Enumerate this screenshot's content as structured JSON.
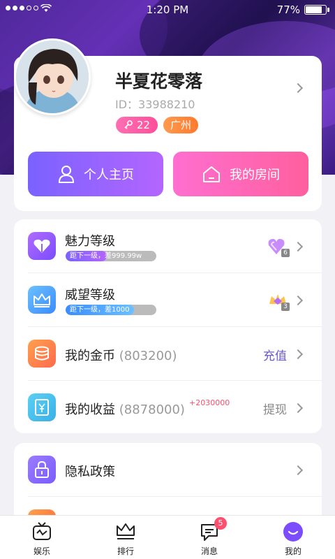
{
  "status_bar": {
    "time": "1:20 PM",
    "battery": "77%"
  },
  "profile": {
    "name": "半夏花零落",
    "id_label": "ID：",
    "id": "33988210",
    "level": "22",
    "city": "广州"
  },
  "actions": {
    "home_label": "个人主页",
    "room_label": "我的房间"
  },
  "rows": [
    {
      "title": "魅力等级",
      "progress_text": "距下一级，差999.99w",
      "progress": 0.45,
      "level_icon": "purple-heart-gem-icon",
      "level": "6"
    },
    {
      "title": "威望等级",
      "progress_text": "距下一级，差1000",
      "progress": 0.75,
      "level_icon": "gold-crown-gem-icon",
      "level": "3"
    },
    {
      "title": "我的金币",
      "value": "(803200)",
      "action": "充值",
      "action_color": "#6a5acd"
    },
    {
      "title": "我的收益",
      "value": "(8878000)",
      "plus": "+2030000",
      "action": "提现",
      "action_color": "#888888"
    }
  ],
  "settings": {
    "privacy": "隐私政策"
  },
  "tabbar": {
    "tabs": [
      {
        "label": "娱乐",
        "icon": "tv-icon"
      },
      {
        "label": "排行",
        "icon": "crown-icon"
      },
      {
        "label": "消息",
        "icon": "message-icon",
        "badge": "5"
      },
      {
        "label": "我的",
        "icon": "smile-icon",
        "active": true
      }
    ]
  },
  "colors": {
    "hero": "#4a2a8a",
    "home_btn": "#8a63ff",
    "room_btn": "#ff66b8",
    "active_tab": "#7b4dff"
  }
}
